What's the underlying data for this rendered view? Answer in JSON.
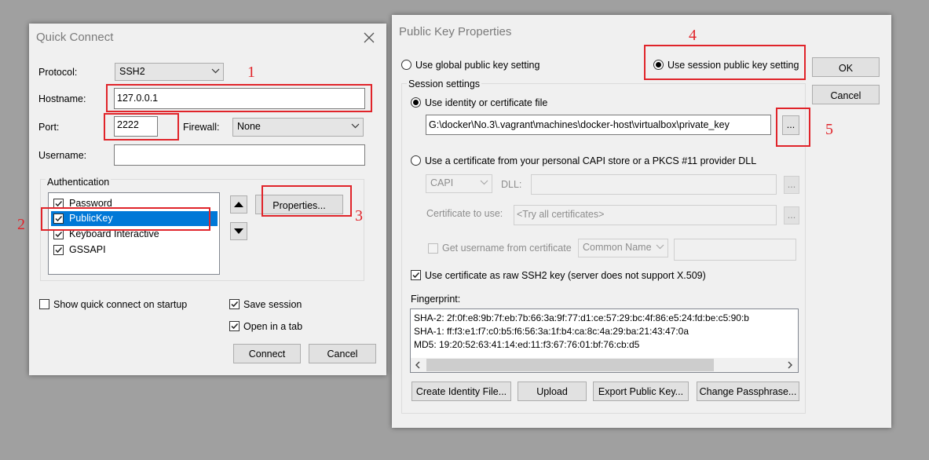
{
  "quick_connect": {
    "title": "Quick Connect",
    "protocol_label": "Protocol:",
    "protocol_value": "SSH2",
    "hostname_label": "Hostname:",
    "hostname_value": "127.0.0.1",
    "port_label": "Port:",
    "port_value": "2222",
    "firewall_label": "Firewall:",
    "firewall_value": "None",
    "username_label": "Username:",
    "username_value": "",
    "auth_group_label": "Authentication",
    "auth_items": [
      "Password",
      "PublicKey",
      "Keyboard Interactive",
      "GSSAPI"
    ],
    "properties_button": "Properties...",
    "show_on_startup": "Show quick connect on startup",
    "save_session": "Save session",
    "open_in_tab": "Open in a tab",
    "connect_button": "Connect",
    "cancel_button": "Cancel"
  },
  "pubkey": {
    "title": "Public Key Properties",
    "use_global": "Use global public key setting",
    "use_session": "Use session public key setting",
    "ok_button": "OK",
    "cancel_button": "Cancel",
    "session_settings_label": "Session settings",
    "use_identity": "Use identity or certificate file",
    "identity_path": "G:\\docker\\No.3\\.vagrant\\machines\\docker-host\\virtualbox\\private_key",
    "browse_button": "...",
    "use_capi": "Use a certificate from your personal CAPI store or a PKCS #11 provider DLL",
    "capi_value": "CAPI",
    "dll_label": "DLL:",
    "cert_to_use_label": "Certificate to use:",
    "cert_to_use_value": "<Try all certificates>",
    "get_username": "Get username from certificate",
    "common_name": "Common Name",
    "raw_ssh2": "Use certificate as raw SSH2 key (server does not support X.509)",
    "fingerprint_label": "Fingerprint:",
    "fingerprint_lines": [
      "SHA-2: 2f:0f:e8:9b:7f:eb:7b:66:3a:9f:77:d1:ce:57:29:bc:4f:86:e5:24:fd:be:c5:90:b",
      "SHA-1: ff:f3:e1:f7:c0:b5:f6:56:3a:1f:b4:ca:8c:4a:29:ba:21:43:47:0a",
      "MD5: 19:20:52:63:41:14:ed:11:f3:67:76:01:bf:76:cb:d5"
    ],
    "create_identity_button": "Create Identity File...",
    "upload_button": "Upload",
    "export_button": "Export Public Key...",
    "change_pass_button": "Change Passphrase..."
  },
  "annotations": [
    "1",
    "2",
    "3",
    "4",
    "5"
  ],
  "colors": {
    "annotation": "#e0242a",
    "selection": "#0078d7"
  }
}
